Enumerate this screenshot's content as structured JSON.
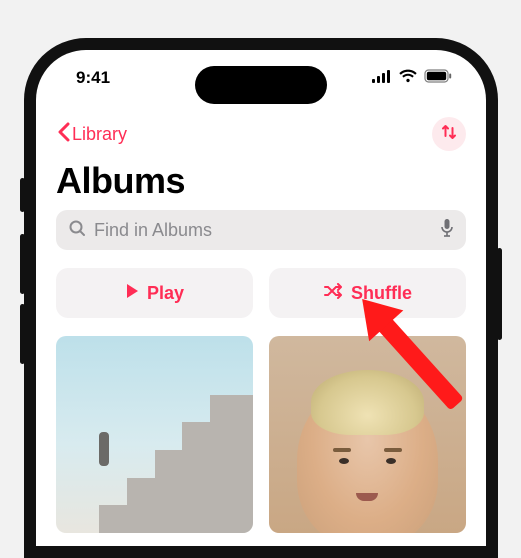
{
  "status": {
    "time": "9:41"
  },
  "nav": {
    "back_label": "Library"
  },
  "page": {
    "title": "Albums"
  },
  "search": {
    "placeholder": "Find in Albums"
  },
  "actions": {
    "play_label": "Play",
    "shuffle_label": "Shuffle"
  },
  "colors": {
    "accent": "#ff2d55"
  }
}
